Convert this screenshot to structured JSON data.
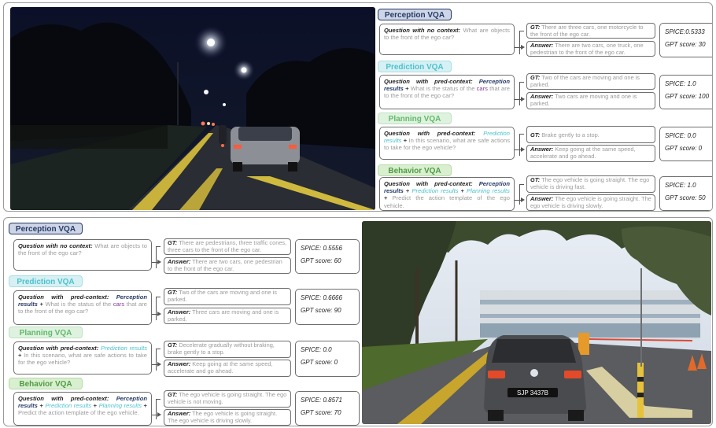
{
  "labels": {
    "perception": "Perception VQA",
    "prediction": "Prediction VQA",
    "planning": "Planning VQA",
    "behavior": "Behavior VQA",
    "q_no_context": "Question with no context:",
    "q_pred_context": "Question with pred-context:",
    "gt": "GT:",
    "answer": "Answer:",
    "ctx_perception": "Perception results",
    "ctx_prediction": "Prediction results",
    "ctx_planning": "Planning results",
    "plus": "+"
  },
  "questions": {
    "perception": "What are objects to the front of the ego car?",
    "prediction_pre": "What is the status of the",
    "prediction_cars": "cars",
    "prediction_post": "that are to the front of the ego car?",
    "planning": "In this scenario, what are safe actions to take for the ego vehicle?",
    "behavior": "Predict the action template of the ego vehicle."
  },
  "examples": [
    {
      "scene": "night",
      "perception": {
        "gt": "There are three cars, one motorcycle to the front of the ego car.",
        "answer": "There are two cars, one truck, one pedestrian to the front of the ego car.",
        "spice": "SPICE:0.5333",
        "gpt": "GPT score: 30"
      },
      "prediction": {
        "gt": "Two of the cars are moving and one is parked.",
        "answer": "Two cars are moving and one is parked.",
        "spice": "SPICE: 1.0",
        "gpt": "GPT score: 100"
      },
      "planning": {
        "gt": "Brake gently to a stop.",
        "answer": "Keep going at the same speed, accelerate and go ahead.",
        "spice": "SPICE: 0.0",
        "gpt": "GPT score: 0"
      },
      "behavior": {
        "gt": "The ego vehicle is going straight. The ego vehicle is driving fast.",
        "answer": "The ego vehicle is going straight. The ego vehicle is driving slowly.",
        "spice": "SPICE: 1.0",
        "gpt": "GPT score: 50"
      }
    },
    {
      "scene": "day",
      "perception": {
        "gt": "There are pedestrians, three traffic cones, three cars to the front of the ego car.",
        "answer": "There are two cars, one pedestrian to the front of the ego car.",
        "spice": "SPICE: 0.5556",
        "gpt": "GPT score: 60"
      },
      "prediction": {
        "gt": "Two of the cars are moving and one is parked.",
        "answer": "Three cars are moving and one is parked.",
        "spice": "SPICE: 0.6666",
        "gpt": "GPT score: 90"
      },
      "planning": {
        "gt": "Decelerate gradually without braking, brake gently to a stop.",
        "answer": "Keep going at the same speed, accelerate and go ahead.",
        "spice": "SPICE: 0.0",
        "gpt": "GPT score: 0"
      },
      "behavior": {
        "gt": "The ego vehicle is going straight. The ego vehicle is not moving.",
        "answer": "The ego vehicle is going straight. The ego vehicle is driving slowly.",
        "spice": "SPICE: 0.8571",
        "gpt": "GPT score: 70"
      }
    }
  ],
  "plate_text": "SJP 3437B",
  "colors": {
    "perception": "#263a66",
    "prediction": "#4cc2ce",
    "planning": "#63b96b",
    "behavior": "#4f9b46",
    "cars_highlight": "#8b3a9a"
  }
}
